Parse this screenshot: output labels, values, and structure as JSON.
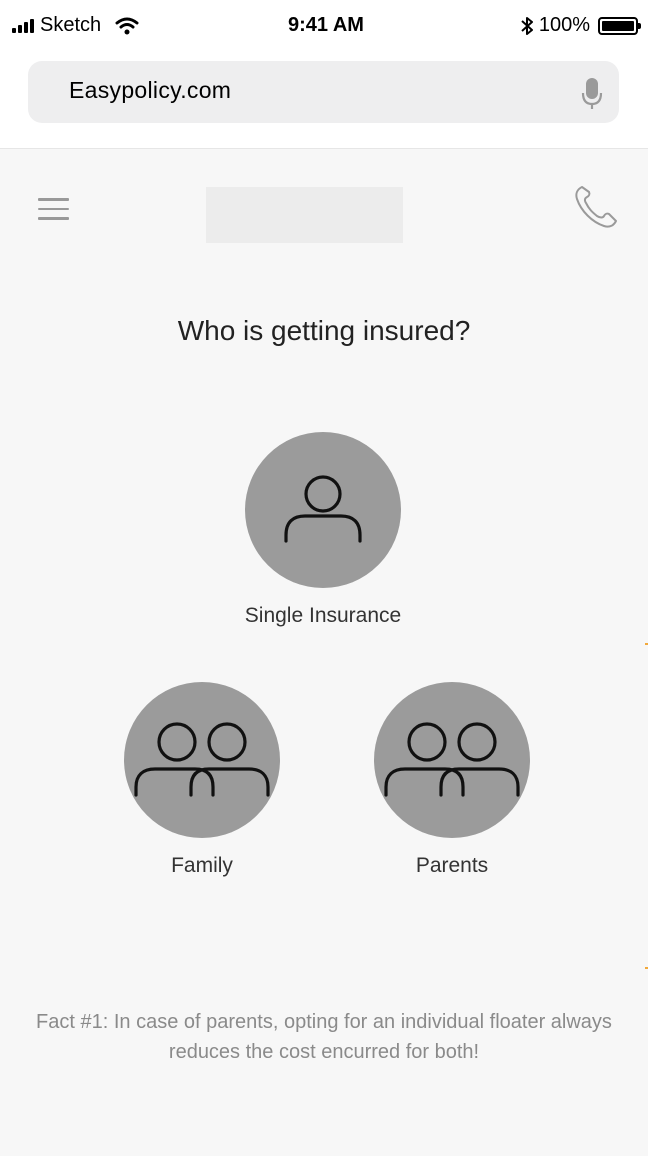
{
  "status_bar": {
    "carrier": "Sketch",
    "time": "9:41 AM",
    "battery": "100%"
  },
  "address_bar": {
    "url": "Easypolicy.com"
  },
  "icons": {
    "menu": "hamburger-icon",
    "phone": "phone-icon",
    "mic": "microphone-icon",
    "person": "person-icon",
    "two_people": "two-people-icon"
  },
  "page": {
    "question": "Who is getting insured?",
    "options": [
      {
        "label": "Single Insurance"
      },
      {
        "label": "Family"
      },
      {
        "label": "Parents"
      }
    ],
    "fact": "Fact #1: In case of parents, opting for an individual floater always reduces the cost encurred for both!"
  },
  "colors": {
    "circle": "#9b9b9b",
    "background": "#f7f7f7",
    "fact_text": "#8a8a8a"
  }
}
